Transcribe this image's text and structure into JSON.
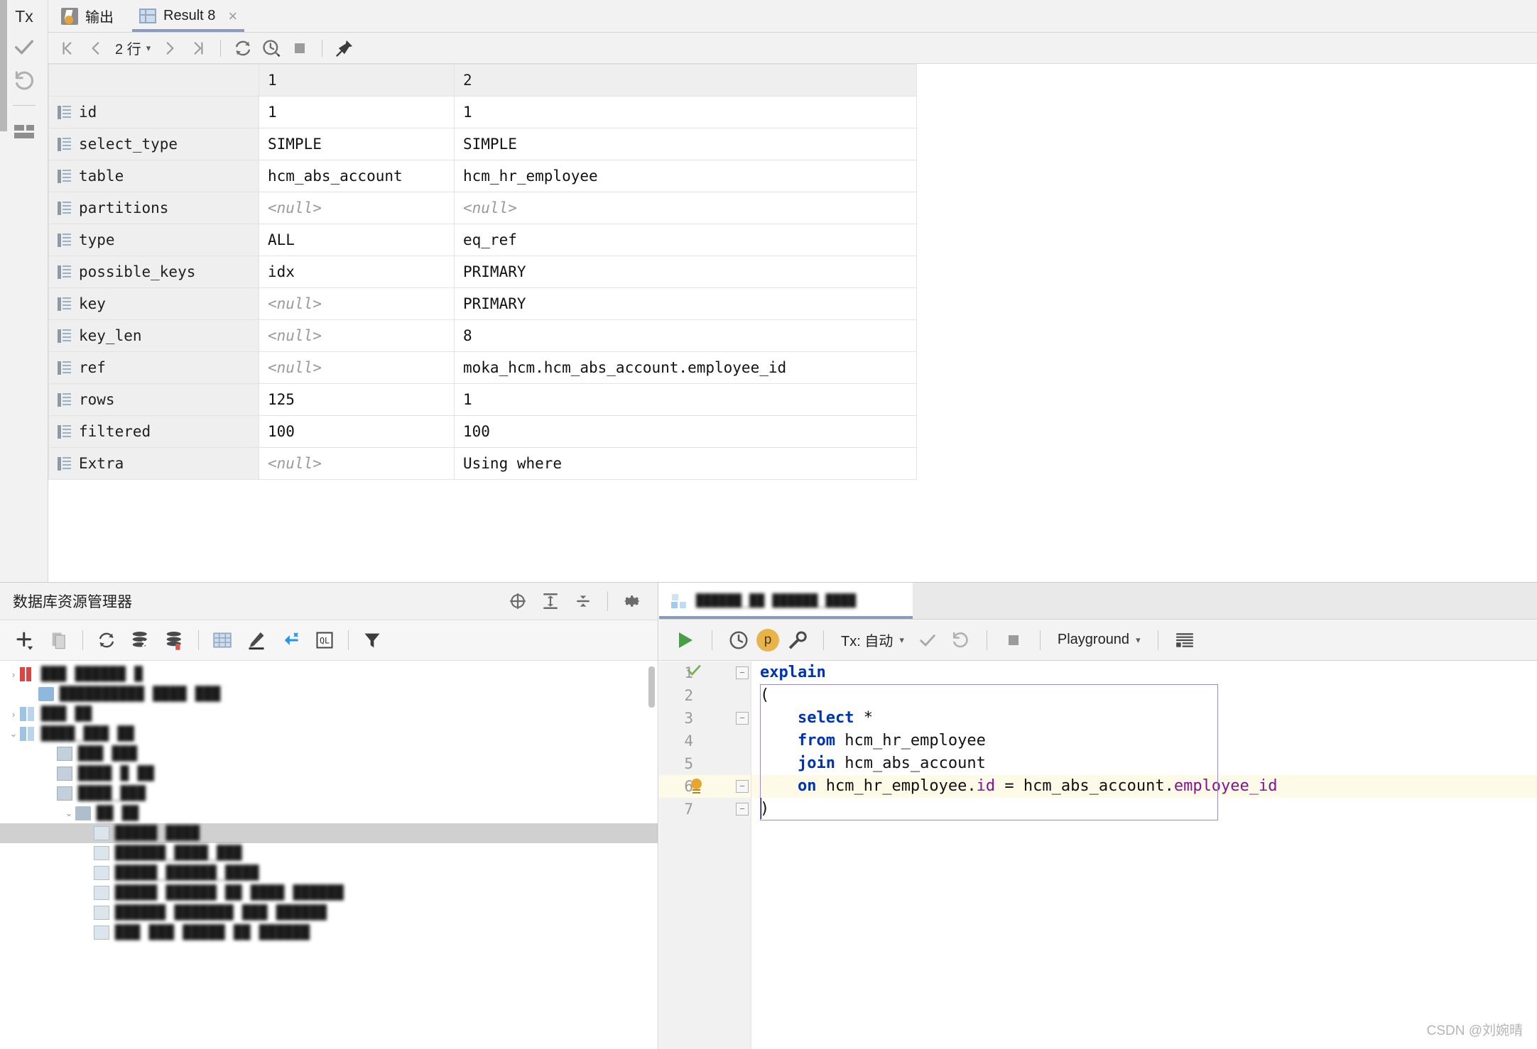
{
  "rail": {
    "tx_label": "Tx",
    "commit_icon": "checkmark-icon",
    "rollback_icon": "rollback-icon",
    "layout_icon": "layout-icon"
  },
  "top_tabs": [
    {
      "label": "输出",
      "icon": "output-icon",
      "active": false,
      "closable": false
    },
    {
      "label": "Result 8",
      "icon": "result-grid-icon",
      "active": true,
      "closable": true,
      "close_label": "×"
    }
  ],
  "result_toolbar": {
    "first_page_icon": "first-page-icon",
    "prev_page_icon": "prev-page-icon",
    "row_count": "2 行",
    "row_count_chevron": "▾",
    "next_page_icon": "next-page-icon",
    "last_page_icon": "last-page-icon",
    "refresh_icon": "refresh-icon",
    "history_icon": "query-history-icon",
    "stop_icon": "stop-icon",
    "pin_icon": "pin-icon"
  },
  "grid": {
    "column_headers": [
      "",
      "1",
      "2"
    ],
    "rows": [
      {
        "field": "id",
        "v1": "1",
        "v2": "1",
        "v1_null": false,
        "v2_null": false
      },
      {
        "field": "select_type",
        "v1": "SIMPLE",
        "v2": "SIMPLE",
        "v1_null": false,
        "v2_null": false
      },
      {
        "field": "table",
        "v1": "hcm_abs_account",
        "v2": "hcm_hr_employee",
        "v1_null": false,
        "v2_null": false
      },
      {
        "field": "partitions",
        "v1": "<null>",
        "v2": "<null>",
        "v1_null": true,
        "v2_null": true
      },
      {
        "field": "type",
        "v1": "ALL",
        "v2": "eq_ref",
        "v1_null": false,
        "v2_null": false
      },
      {
        "field": "possible_keys",
        "v1": "idx",
        "v2": "PRIMARY",
        "v1_null": false,
        "v2_null": false
      },
      {
        "field": "key",
        "v1": "<null>",
        "v2": "PRIMARY",
        "v1_null": true,
        "v2_null": false
      },
      {
        "field": "key_len",
        "v1": "<null>",
        "v2": "8",
        "v1_null": true,
        "v2_null": false
      },
      {
        "field": "ref",
        "v1": "<null>",
        "v2": "moka_hcm.hcm_abs_account.employee_id",
        "v1_null": true,
        "v2_null": false
      },
      {
        "field": "rows",
        "v1": "125",
        "v2": "1",
        "v1_null": false,
        "v2_null": false
      },
      {
        "field": "filtered",
        "v1": "100",
        "v2": "100",
        "v1_null": false,
        "v2_null": false
      },
      {
        "field": "Extra",
        "v1": "<null>",
        "v2": "Using where",
        "v1_null": true,
        "v2_null": false
      }
    ]
  },
  "db_explorer": {
    "title": "数据库资源管理器",
    "header_icons": [
      "locate-icon",
      "expand-all-icon",
      "collapse-all-icon",
      "settings-gear-icon"
    ],
    "toolbar_icons": [
      "add-icon",
      "copy-icon",
      "refresh-icon",
      "sync-schema-icon",
      "database-color-icon",
      "table-icon",
      "edit-icon",
      "jump-to-icon",
      "query-console-icon",
      "filter-icon"
    ],
    "tree_items": [
      {
        "text": "███ ██████ █",
        "indent": 0,
        "icon": "db",
        "arrow": "›",
        "selected": false
      },
      {
        "text": "██████████ ████ ███",
        "indent": 1,
        "icon": "sch",
        "arrow": "",
        "selected": false
      },
      {
        "text": "███ ██",
        "indent": 0,
        "icon": "schm",
        "arrow": "›",
        "selected": false
      },
      {
        "text": "████_███ ██",
        "indent": 0,
        "icon": "schm",
        "arrow": "⌄",
        "selected": false
      },
      {
        "text": "███ ███",
        "indent": 2,
        "icon": "tbl",
        "arrow": "",
        "selected": false
      },
      {
        "text": "████ █ ██",
        "indent": 2,
        "icon": "tbl",
        "arrow": "",
        "selected": false
      },
      {
        "text": "████_███",
        "indent": 2,
        "icon": "tbl",
        "arrow": "",
        "selected": false
      },
      {
        "text": "██ ██",
        "indent": 3,
        "icon": "folder",
        "arrow": "⌄",
        "selected": false
      },
      {
        "text": "█████ ████",
        "indent": 4,
        "icon": "tbl2",
        "arrow": "",
        "selected": true
      },
      {
        "text": "██████_████_███",
        "indent": 4,
        "icon": "tbl2",
        "arrow": "",
        "selected": false
      },
      {
        "text": "█████_██████_████",
        "indent": 4,
        "icon": "tbl2",
        "arrow": "",
        "selected": false
      },
      {
        "text": "█████ ██████ ██ ████ ██████",
        "indent": 4,
        "icon": "tbl2",
        "arrow": "",
        "selected": false
      },
      {
        "text": "██████ ███████ ███ ██████",
        "indent": 4,
        "icon": "tbl2",
        "arrow": "",
        "selected": false
      },
      {
        "text": "███ ███ █████ ██ ██████",
        "indent": 4,
        "icon": "tbl2",
        "arrow": "",
        "selected": false
      }
    ]
  },
  "sql_editor": {
    "file_tab_label": "██████_██ ██████_████",
    "toolbar": {
      "run_icon": "run-play-icon",
      "history_icon": "history-clock-icon",
      "profile_badge": "p",
      "settings_icon": "wrench-icon",
      "tx_label": "Tx: 自动",
      "tx_chevron": "▾",
      "commit_icon": "commit-check-icon",
      "rollback_icon": "rollback-icon",
      "stop_icon": "stop-icon",
      "schema_label": "Playground",
      "schema_chevron": "▾",
      "output_format_icon": "output-format-icon"
    },
    "line_numbers": [
      "1",
      "2",
      "3",
      "4",
      "5",
      "6",
      "7"
    ],
    "gutter_status_icon": "green-check-icon",
    "highlight_line": 6,
    "code_lines": [
      {
        "n": 1,
        "segments": [
          {
            "t": "explain",
            "c": "kw"
          }
        ]
      },
      {
        "n": 2,
        "segments": [
          {
            "t": "(",
            "c": "plain"
          }
        ]
      },
      {
        "n": 3,
        "segments": [
          {
            "t": "    ",
            "c": "plain"
          },
          {
            "t": "select",
            "c": "kw"
          },
          {
            "t": " *",
            "c": "plain"
          }
        ]
      },
      {
        "n": 4,
        "segments": [
          {
            "t": "    ",
            "c": "plain"
          },
          {
            "t": "from",
            "c": "kw"
          },
          {
            "t": " hcm_hr_employee",
            "c": "plain"
          }
        ]
      },
      {
        "n": 5,
        "segments": [
          {
            "t": "    ",
            "c": "plain"
          },
          {
            "t": "join",
            "c": "kw"
          },
          {
            "t": " hcm_abs_account",
            "c": "plain"
          }
        ]
      },
      {
        "n": 6,
        "segments": [
          {
            "t": "    ",
            "c": "plain"
          },
          {
            "t": "on",
            "c": "kw"
          },
          {
            "t": " hcm_hr_employee.",
            "c": "plain"
          },
          {
            "t": "id",
            "c": "col"
          },
          {
            "t": " = hcm_abs_account.",
            "c": "plain"
          },
          {
            "t": "employee_id",
            "c": "col"
          }
        ]
      },
      {
        "n": 7,
        "segments": [
          {
            "t": ")",
            "c": "plain"
          }
        ]
      }
    ]
  },
  "watermark": "CSDN @刘婉晴",
  "colors": {
    "accent_tab_underline": "#8a9bbd",
    "keyword": "#0033b3",
    "column_ref": "#871094",
    "highlight_row": "#fdfbe8",
    "selection_border": "#9b8ec8",
    "run_green": "#4a9c4a"
  }
}
